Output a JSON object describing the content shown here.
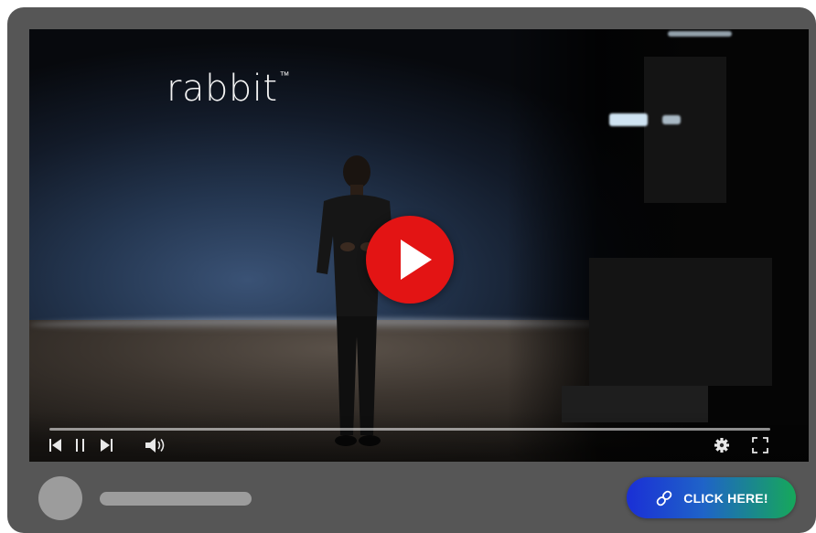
{
  "video": {
    "brand_text": "rabbit",
    "brand_mark": "™",
    "progress_fraction": 0.0,
    "icons": {
      "play": "play-icon",
      "previous": "skip-previous-icon",
      "pause": "pause-icon",
      "next": "skip-next-icon",
      "volume": "volume-icon",
      "settings": "gear-icon",
      "fullscreen": "fullscreen-icon"
    }
  },
  "footer": {
    "cta_label": "CLICK HERE!",
    "cta_icon": "link-icon"
  },
  "colors": {
    "card": "#565656",
    "play_button": "#e31414",
    "placeholder": "#9c9c9c",
    "cta_gradient_start": "#1a2fd6",
    "cta_gradient_end": "#16a85a"
  }
}
